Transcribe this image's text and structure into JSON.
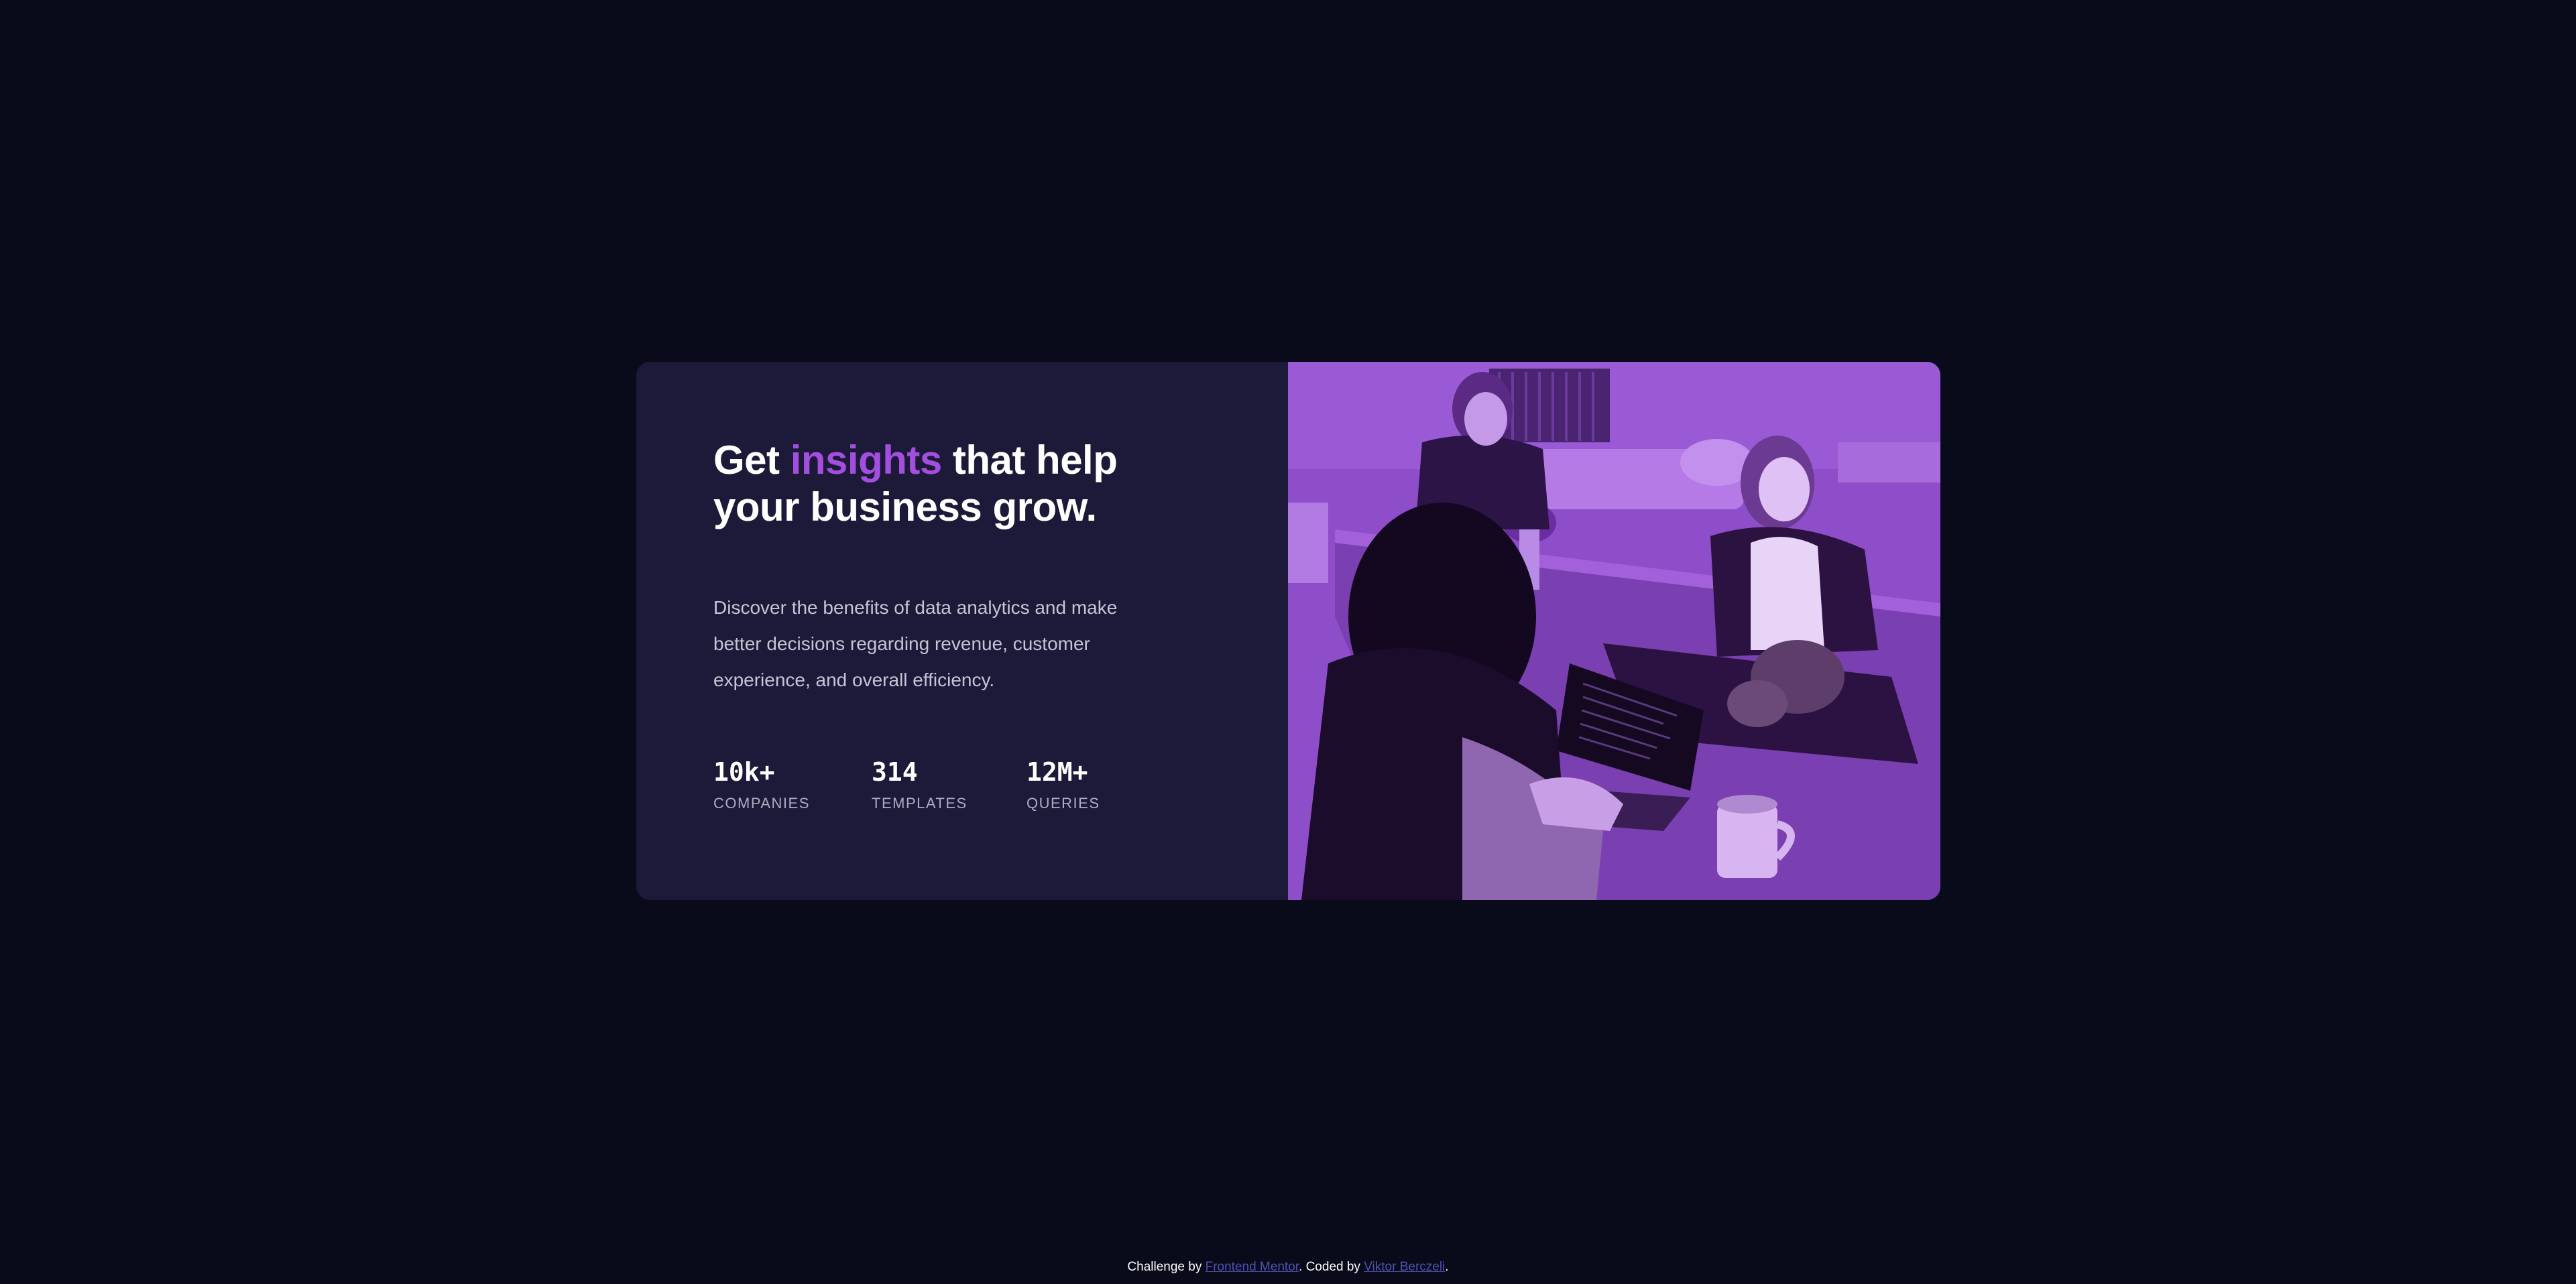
{
  "hero": {
    "headline_pre": "Get ",
    "headline_accent": "insights",
    "headline_post": " that help your business grow.",
    "description": "Discover the benefits of data analytics and make better decisions regarding revenue, customer experience, and overall efficiency."
  },
  "stats": [
    {
      "value": "10k+",
      "label": "COMPANIES"
    },
    {
      "value": "314",
      "label": "TEMPLATES"
    },
    {
      "value": "12M+",
      "label": "QUERIES"
    }
  ],
  "footer": {
    "challenge_prefix": "Challenge by ",
    "challenge_link": "Frontend Mentor",
    "coded_prefix": ". Coded by ",
    "coded_link": "Viktor Berczeli",
    "suffix": "."
  },
  "colors": {
    "page_background": "#090b1b",
    "card_background": "#1c1a38",
    "accent": "#a44ee0",
    "image_overlay": "#8e4dc9",
    "link": "#4f50b0"
  }
}
